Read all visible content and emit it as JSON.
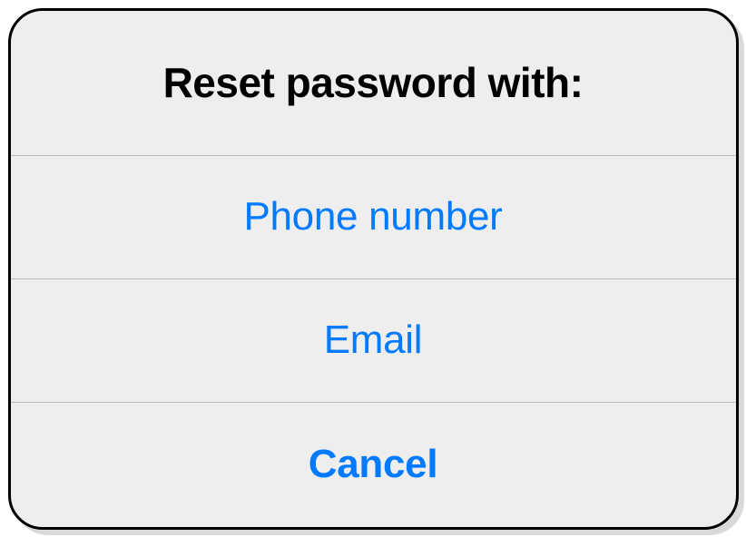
{
  "dialog": {
    "title": "Reset password with:",
    "options": [
      {
        "label": "Phone number"
      },
      {
        "label": "Email"
      }
    ],
    "cancel_label": "Cancel"
  },
  "colors": {
    "accent": "#007aff",
    "background": "#eeeeef",
    "separator": "#b9b9bb",
    "border": "#000000"
  }
}
